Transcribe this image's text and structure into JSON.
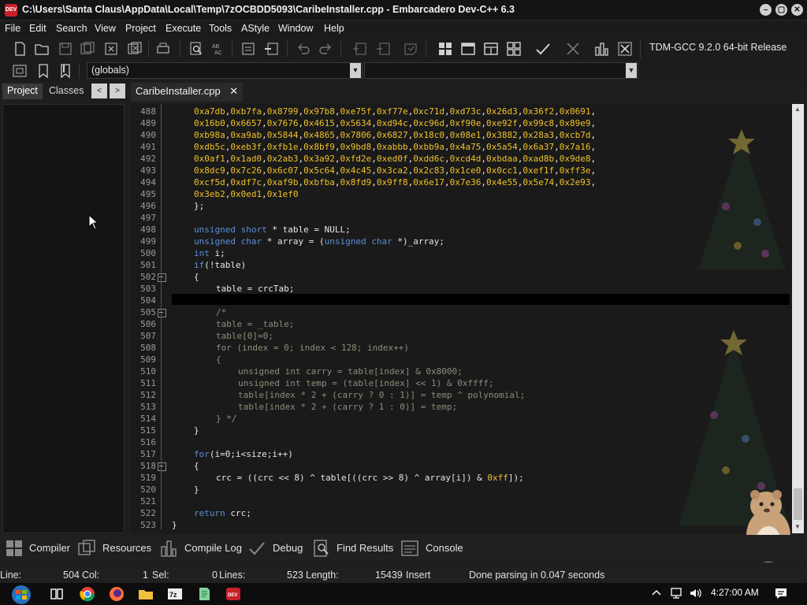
{
  "window": {
    "title": "C:\\Users\\Santa Claus\\AppData\\Local\\Temp\\7zOCBDD5093\\CaribeInstaller.cpp - Embarcadero Dev-C++ 6.3",
    "app_icon_text": "DEV",
    "controls": {
      "minimize": "–",
      "maximize": "▢",
      "close": "✕"
    }
  },
  "menu": [
    "File",
    "Edit",
    "Search",
    "View",
    "Project",
    "Execute",
    "Tools",
    "AStyle",
    "Window",
    "Help"
  ],
  "toolbar": {
    "compiler": "TDM-GCC 9.2.0 64-bit Release",
    "scope_combo": "(globals)",
    "symbol_combo": ""
  },
  "left_panel": {
    "tabs": [
      "Project",
      "Classes"
    ],
    "prev_arrow": "<",
    "next_arrow": ">"
  },
  "editor": {
    "file_tab": "CaribeInstaller.cpp",
    "close_glyph": "✕",
    "lines": [
      {
        "n": "488",
        "t": "0xa7db,0xb7fa,0x8799,0x97b8,0xe75f,0xf77e,0xc71d,0xd73c,0x26d3,0x36f2,0x0691,",
        "c": "num",
        "i": 1
      },
      {
        "n": "489",
        "t": "0x16b0,0x6657,0x7676,0x4615,0x5634,0xd94c,0xc96d,0xf90e,0xe92f,0x99c8,0x89e9,",
        "c": "num",
        "i": 1
      },
      {
        "n": "490",
        "t": "0xb98a,0xa9ab,0x5844,0x4865,0x7806,0x6827,0x18c0,0x08e1,0x3882,0x28a3,0xcb7d,",
        "c": "num",
        "i": 1
      },
      {
        "n": "491",
        "t": "0xdb5c,0xeb3f,0xfb1e,0x8bf9,0x9bd8,0xabbb,0xbb9a,0x4a75,0x5a54,0x6a37,0x7a16,",
        "c": "num",
        "i": 1
      },
      {
        "n": "492",
        "t": "0x0af1,0x1ad0,0x2ab3,0x3a92,0xfd2e,0xed0f,0xdd6c,0xcd4d,0xbdaa,0xad8b,0x9de8,",
        "c": "num",
        "i": 1
      },
      {
        "n": "493",
        "t": "0x8dc9,0x7c26,0x6c07,0x5c64,0x4c45,0x3ca2,0x2c83,0x1ce0,0x0cc1,0xef1f,0xff3e,",
        "c": "num",
        "i": 1
      },
      {
        "n": "494",
        "t": "0xcf5d,0xdf7c,0xaf9b,0xbfba,0x8fd9,0x9ff8,0x6e17,0x7e36,0x4e55,0x5e74,0x2e93,",
        "c": "num",
        "i": 1
      },
      {
        "n": "495",
        "t": "0x3eb2,0x0ed1,0x1ef0",
        "c": "num",
        "i": 1
      },
      {
        "n": "496",
        "t": "};",
        "c": "",
        "i": 1
      },
      {
        "n": "497",
        "t": "",
        "c": "",
        "i": 1
      },
      {
        "n": "498",
        "t": "unsigned short * table = NULL;",
        "c": "mix1",
        "i": 1
      },
      {
        "n": "499",
        "t": "unsigned char * array = (unsigned char *)_array;",
        "c": "mix2",
        "i": 1
      },
      {
        "n": "500",
        "t": "int i;",
        "c": "mix3",
        "i": 1
      },
      {
        "n": "501",
        "t": "if(!table)",
        "c": "",
        "i": 1
      },
      {
        "n": "502",
        "t": "{",
        "c": "",
        "i": 1
      },
      {
        "n": "503",
        "t": "table = crcTab;",
        "c": "",
        "i": 2
      },
      {
        "n": "504",
        "t": "",
        "c": "",
        "i": 2
      },
      {
        "n": "505",
        "t": "/*",
        "c": "cm",
        "i": 2
      },
      {
        "n": "506",
        "t": "table = _table;",
        "c": "cm",
        "i": 2
      },
      {
        "n": "507",
        "t": "table[0]=0;",
        "c": "cm",
        "i": 2
      },
      {
        "n": "508",
        "t": "for (index = 0; index < 128; index++)",
        "c": "cm",
        "i": 2
      },
      {
        "n": "509",
        "t": "{",
        "c": "cm",
        "i": 2
      },
      {
        "n": "510",
        "t": "unsigned int carry = table[index] & 0x8000;",
        "c": "cm",
        "i": 3
      },
      {
        "n": "511",
        "t": "unsigned int temp = (table[index] << 1) & 0xffff;",
        "c": "cm",
        "i": 3
      },
      {
        "n": "512",
        "t": "table[index * 2 + (carry ? 0 : 1)] = temp ^ polynomial;",
        "c": "cm",
        "i": 3
      },
      {
        "n": "513",
        "t": "table[index * 2 + (carry ? 1 : 0)] = temp;",
        "c": "cm",
        "i": 3
      },
      {
        "n": "514",
        "t": "} */",
        "c": "cm",
        "i": 2
      },
      {
        "n": "515",
        "t": "}",
        "c": "",
        "i": 1
      },
      {
        "n": "516",
        "t": "",
        "c": "",
        "i": 1
      },
      {
        "n": "517",
        "t": "for(i=0;i<size;i++)",
        "c": "mix4",
        "i": 1
      },
      {
        "n": "518",
        "t": "{",
        "c": "",
        "i": 1
      },
      {
        "n": "519",
        "t": "crc = ((crc << 8) ^ table[((crc >> 8) ^ array[i]) & 0xff]);",
        "c": "mix5",
        "i": 2
      },
      {
        "n": "520",
        "t": "}",
        "c": "",
        "i": 1
      },
      {
        "n": "521",
        "t": "",
        "c": "",
        "i": 1
      },
      {
        "n": "522",
        "t": "return crc;",
        "c": "mix6",
        "i": 1
      },
      {
        "n": "523",
        "t": "}",
        "c": "",
        "i": 0
      }
    ]
  },
  "bottom_tabs": [
    "Compiler",
    "Resources",
    "Compile Log",
    "Debug",
    "Find Results",
    "Console"
  ],
  "status": {
    "line_label": "Line:",
    "line_value": "504",
    "col_label": "Col:",
    "col_value": "1",
    "sel_label": "Sel:",
    "sel_value": "0",
    "lines_label": "Lines:",
    "lines_value": "523",
    "length_label": "Length:",
    "length_value": "15439",
    "mode": "Insert",
    "message": "Done parsing in 0.047 seconds"
  },
  "taskbar": {
    "clock": "4:27:00 AM",
    "items": [
      "start-button",
      "task-view",
      "chrome",
      "firefox",
      "file-explorer",
      "7zip",
      "notepad",
      "devcpp"
    ]
  },
  "colors": {
    "keyword": "#5e8fd8",
    "number": "#f0c229",
    "comment": "#8c8c7a",
    "current_line": "#000000",
    "brand": "#c8202a"
  }
}
